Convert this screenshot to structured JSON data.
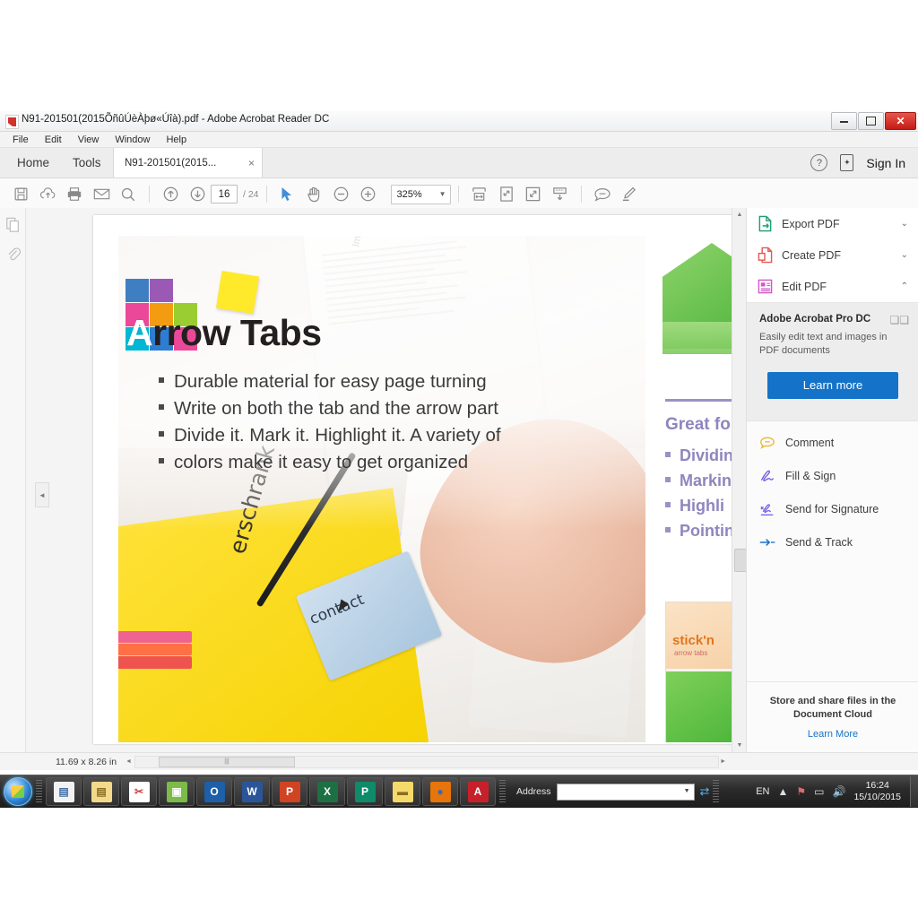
{
  "window": {
    "title": "N91-201501(2015ÕñûÚèÀþø«Úîà).pdf - Adobe Acrobat Reader DC",
    "app_icon": "pdf-file-icon",
    "minimize": "minimize-button",
    "maximize": "maximize-button",
    "close": "close-button"
  },
  "menubar": {
    "items": [
      "File",
      "Edit",
      "View",
      "Window",
      "Help"
    ]
  },
  "tabstrip": {
    "home": "Home",
    "tools": "Tools",
    "document_tab": "N91-201501(2015...",
    "close_tab": "×",
    "help": "?",
    "sign_in": "Sign In"
  },
  "toolbar": {
    "save": "save-icon",
    "upload": "cloud-upload-icon",
    "print": "print-icon",
    "email": "email-icon",
    "search": "search-icon",
    "prev_page": "previous-page-icon",
    "next_page": "next-page-icon",
    "page_current": "16",
    "page_total": "/ 24",
    "select": "select-cursor-icon",
    "hand": "hand-tool-icon",
    "zoom_out": "zoom-out-icon",
    "zoom_in": "zoom-in-icon",
    "zoom_level": "325%",
    "fit_width": "fit-width-icon",
    "rotate": "rotate-page-icon",
    "fullscreen": "fullscreen-icon",
    "scroll_mode": "scroll-mode-icon",
    "comment": "comment-icon",
    "highlight": "highlight-icon"
  },
  "leftrail": {
    "thumbnails": "page-thumbnails-icon",
    "attachments": "attachments-icon"
  },
  "document": {
    "nav_prev": "◄",
    "nav_next": "►",
    "slide": {
      "title_first_letter": "A",
      "title_rest": "rrow Tabs",
      "bullets": [
        "Durable material  for easy page turning",
        "Write on both the tab and the arrow part",
        "Divide it. Mark it. Highlight it. A variety of",
        "colors make it easy to get organized"
      ],
      "photo_text_handwritten": "erschrank",
      "photo_text_tab": "contact",
      "right_heading": "Great fo",
      "right_bullets": [
        "Dividin",
        "Markin",
        "Highli",
        "Pointin"
      ],
      "package_brand": "stick'n",
      "package_sub": "arrow tabs",
      "logo_colors": [
        "#3f7fc1",
        "#9b59b6",
        "#ffffff",
        "#ec4899",
        "#f39c12",
        "#9acd32",
        "#00b8d4",
        "#2d7dd2",
        "#ec4899"
      ]
    }
  },
  "right_panel": {
    "rows": [
      {
        "label": "Export PDF",
        "icon": "export-pdf-icon",
        "chevron": "⌄",
        "color": "#1f9d73"
      },
      {
        "label": "Create PDF",
        "icon": "create-pdf-icon",
        "chevron": "⌄",
        "color": "#e05a55"
      },
      {
        "label": "Edit PDF",
        "icon": "edit-pdf-icon",
        "chevron": "⌃",
        "color": "#d158c7"
      }
    ],
    "promo": {
      "title": "Adobe Acrobat Pro DC",
      "description": "Easily edit text and images in PDF documents",
      "button": "Learn more"
    },
    "tools": [
      {
        "label": "Comment",
        "icon": "comment-icon",
        "color": "#e8b931"
      },
      {
        "label": "Fill & Sign",
        "icon": "fill-sign-icon",
        "color": "#6b5ce7"
      },
      {
        "label": "Send for Signature",
        "icon": "send-for-signature-icon",
        "color": "#6b5ce7"
      },
      {
        "label": "Send & Track",
        "icon": "send-track-icon",
        "color": "#1473c8"
      }
    ],
    "cloud": {
      "text": "Store and share files in the Document Cloud",
      "link": "Learn More"
    }
  },
  "statusbar": {
    "dimensions": "11.69 x 8.26 in",
    "scroll_left": "◄",
    "scroll_right": "►",
    "thumb_grip": "|||"
  },
  "taskbar": {
    "start": "start-orb-icon",
    "apps": [
      {
        "name": "windows-explorer-icon",
        "glyph": "▤",
        "bg": "#f2f2f2",
        "fg": "#3f6fa8"
      },
      {
        "name": "file-folder-icon",
        "glyph": "▤",
        "bg": "#f3d98a",
        "fg": "#8a6d22"
      },
      {
        "name": "scissors-icon",
        "glyph": "✂",
        "bg": "#ffffff",
        "fg": "#d04040"
      },
      {
        "name": "photo-viewer-icon",
        "glyph": "▣",
        "bg": "#7cba4a",
        "fg": "#ffffff"
      },
      {
        "name": "outlook-icon",
        "glyph": "O",
        "bg": "#1d5fa8",
        "fg": "#ffffff"
      },
      {
        "name": "word-icon",
        "glyph": "W",
        "bg": "#2a5699",
        "fg": "#ffffff"
      },
      {
        "name": "powerpoint-icon",
        "glyph": "P",
        "bg": "#d04423",
        "fg": "#ffffff"
      },
      {
        "name": "excel-icon",
        "glyph": "X",
        "bg": "#1d7044",
        "fg": "#ffffff"
      },
      {
        "name": "publisher-icon",
        "glyph": "P",
        "bg": "#0f8a6b",
        "fg": "#ffffff"
      },
      {
        "name": "sticky-notes-icon",
        "glyph": "▬",
        "bg": "#f6d96b",
        "fg": "#8a6d22"
      },
      {
        "name": "firefox-icon",
        "glyph": "●",
        "bg": "#e8740c",
        "fg": "#2f6fb5"
      },
      {
        "name": "acrobat-reader-icon",
        "glyph": "A",
        "bg": "#c8202a",
        "fg": "#ffffff"
      }
    ],
    "address_label": "Address",
    "address_value": "",
    "go_icon": "go-arrow-icon",
    "language": "EN",
    "tray_icons": [
      "show-hidden-icon",
      "network-flag-icon",
      "action-center-icon",
      "volume-icon"
    ],
    "time": "16:24",
    "date": "15/10/2015"
  }
}
